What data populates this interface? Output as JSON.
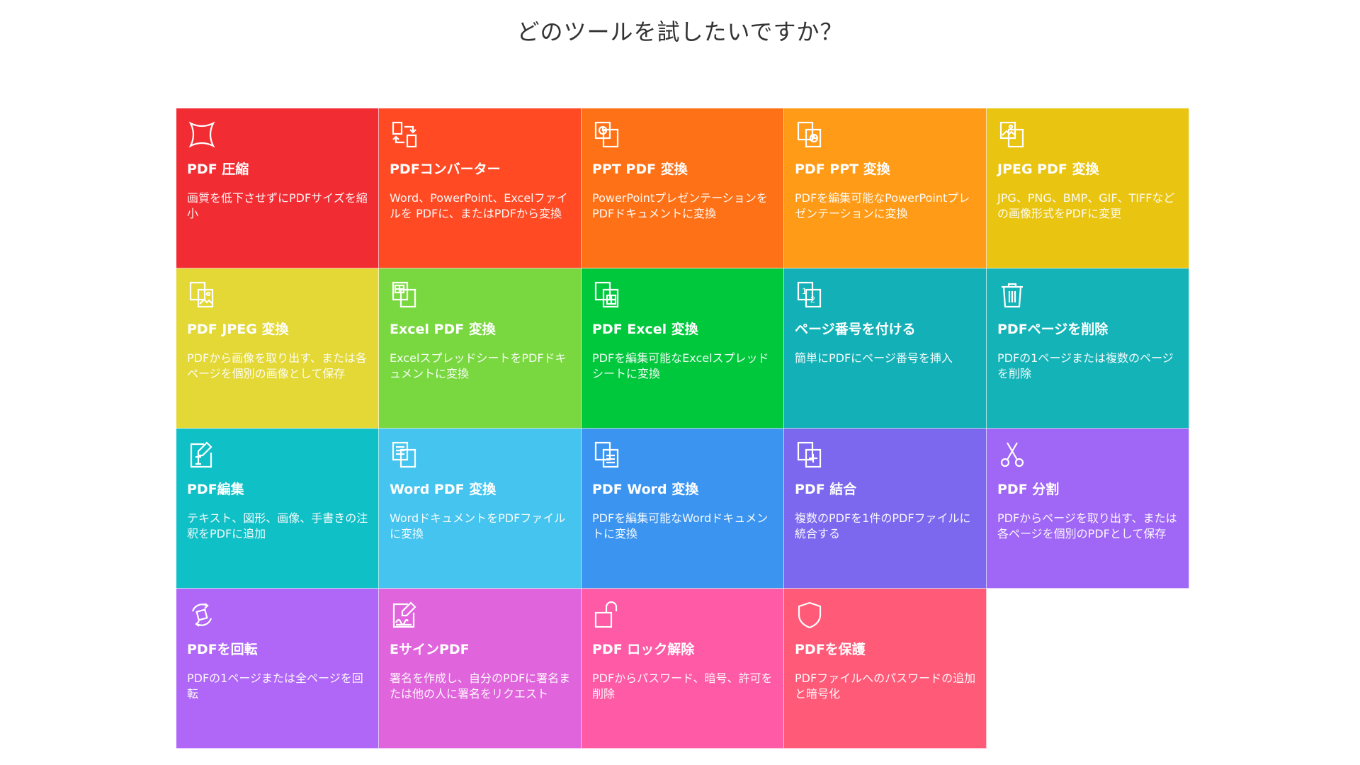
{
  "headline": "どのツールを試したいですか？",
  "tools": [
    {
      "title": "PDF 圧縮",
      "desc": "画質を低下させずにPDFサイズを縮小",
      "color": "#f22c33",
      "icon": "compress-icon"
    },
    {
      "title": "PDFコンバーター",
      "desc": "Word、PowerPoint、Excelファイルを PDFに、またはPDFから変換",
      "color": "#ff4a24",
      "icon": "convert-icon"
    },
    {
      "title": "PPT PDF 変換",
      "desc": "PowerPointプレゼンテーションをPDFドキュメントに変換",
      "color": "#ff7116",
      "icon": "ppt-to-pdf-icon"
    },
    {
      "title": "PDF PPT 変換",
      "desc": "PDFを編集可能なPowerPointプレゼンテーションに変換",
      "color": "#ff9b16",
      "icon": "pdf-to-ppt-icon"
    },
    {
      "title": "JPEG PDF 変換",
      "desc": "JPG、PNG、BMP、GIF、TIFFなどの画像形式をPDFに変更",
      "color": "#e9c411",
      "icon": "jpeg-to-pdf-icon"
    },
    {
      "title": "PDF JPEG 変換",
      "desc": "PDFから画像を取り出す、または各ページを個別の画像として保存",
      "color": "#e3d835",
      "icon": "pdf-to-jpeg-icon"
    },
    {
      "title": "Excel PDF 変換",
      "desc": "ExcelスプレッドシートをPDFドキュメントに変換",
      "color": "#79d83f",
      "icon": "excel-to-pdf-icon"
    },
    {
      "title": "PDF Excel 変換",
      "desc": "PDFを編集可能なExcelスプレッドシートに変換",
      "color": "#00c83c",
      "icon": "pdf-to-excel-icon"
    },
    {
      "title": "ページ番号を付ける",
      "desc": "簡単にPDFにページ番号を挿入",
      "color": "#13b1b7",
      "icon": "page-number-icon"
    },
    {
      "title": "PDFページを削除",
      "desc": "PDFの1ページまたは複数のページを削除",
      "color": "#14b3b8",
      "icon": "trash-icon"
    },
    {
      "title": "PDF編集",
      "desc": "テキスト、図形、画像、手書きの注釈をPDFに追加",
      "color": "#10c0c7",
      "icon": "edit-icon"
    },
    {
      "title": "Word PDF 変換",
      "desc": "WordドキュメントをPDFファイルに変換",
      "color": "#44c4ee",
      "icon": "word-to-pdf-icon"
    },
    {
      "title": "PDF Word 変換",
      "desc": "PDFを編集可能なWordドキュメントに変換",
      "color": "#3b95f0",
      "icon": "pdf-to-word-icon"
    },
    {
      "title": "PDF 結合",
      "desc": "複数のPDFを1件のPDFファイルに統合する",
      "color": "#7b68ee",
      "icon": "merge-icon"
    },
    {
      "title": "PDF 分割",
      "desc": "PDFからページを取り出す、または各ページを個別のPDFとして保存",
      "color": "#a066f5",
      "icon": "scissors-icon"
    },
    {
      "title": "PDFを回転",
      "desc": "PDFの1ページまたは全ページを回転",
      "color": "#b066f7",
      "icon": "rotate-icon"
    },
    {
      "title": "EサインPDF",
      "desc": "署名を作成し、自分のPDFに署名または他の人に署名をリクエスト",
      "color": "#e064dc",
      "icon": "esign-icon"
    },
    {
      "title": "PDF ロック解除",
      "desc": "PDFからパスワード、暗号、許可を削除",
      "color": "#ff5aa5",
      "icon": "unlock-icon"
    },
    {
      "title": "PDFを保護",
      "desc": "PDFファイルへのパスワードの追加と暗号化",
      "color": "#ff5a78",
      "icon": "shield-icon"
    }
  ]
}
